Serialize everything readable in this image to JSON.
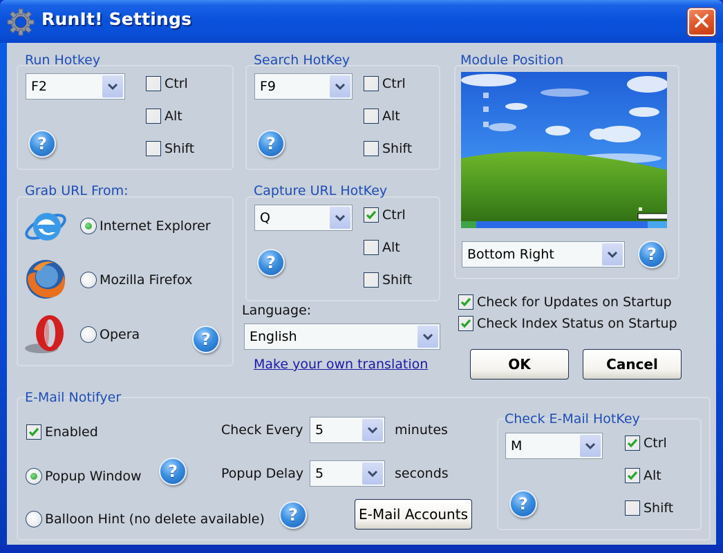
{
  "window": {
    "title": "RunIt! Settings",
    "app_icon": "gear-icon",
    "close_icon": "close-icon"
  },
  "run_hotkey": {
    "title": "Run Hotkey",
    "key": "F2",
    "modifiers": [
      {
        "label": "Ctrl",
        "checked": false
      },
      {
        "label": "Alt",
        "checked": false
      },
      {
        "label": "Shift",
        "checked": false
      }
    ],
    "help": "?"
  },
  "search_hotkey": {
    "title": "Search HotKey",
    "key": "F9",
    "modifiers": [
      {
        "label": "Ctrl",
        "checked": false
      },
      {
        "label": "Alt",
        "checked": false
      },
      {
        "label": "Shift",
        "checked": false
      }
    ],
    "help": "?"
  },
  "module_position": {
    "title": "Module Position",
    "preview_icon": "desktop-preview-image",
    "position": "Bottom Right",
    "help": "?"
  },
  "grab_url": {
    "title": "Grab URL From:",
    "browsers": [
      {
        "label": "Internet Explorer",
        "icon": "internet-explorer-icon",
        "selected": true
      },
      {
        "label": "Mozilla Firefox",
        "icon": "firefox-icon",
        "selected": false
      },
      {
        "label": "Opera",
        "icon": "opera-icon",
        "selected": false
      }
    ],
    "help": "?"
  },
  "capture_url_hotkey": {
    "title": "Capture URL HotKey",
    "key": "Q",
    "modifiers": [
      {
        "label": "Ctrl",
        "checked": true
      },
      {
        "label": "Alt",
        "checked": false
      },
      {
        "label": "Shift",
        "checked": false
      }
    ],
    "help": "?"
  },
  "language": {
    "label": "Language:",
    "value": "English",
    "translation_link": "Make your own translation"
  },
  "startup": {
    "check_updates": {
      "label": "Check for Updates on Startup",
      "checked": true
    },
    "check_index": {
      "label": "Check Index Status on Startup",
      "checked": true
    }
  },
  "buttons": {
    "ok": "OK",
    "cancel": "Cancel",
    "email_accounts": "E-Mail Accounts"
  },
  "email_notifier": {
    "title": "E-Mail Notifyer",
    "enabled": {
      "label": "Enabled",
      "checked": true
    },
    "display_modes": [
      {
        "label": "Popup Window",
        "selected": true
      },
      {
        "label": "Balloon Hint (no delete available)",
        "selected": false
      }
    ],
    "check_every": {
      "label": "Check Every",
      "value": "5",
      "unit": "minutes"
    },
    "popup_delay": {
      "label": "Popup Delay",
      "value": "5",
      "unit": "seconds"
    },
    "help": "?"
  },
  "check_email_hotkey": {
    "title": "Check E-Mail HotKey",
    "key": "M",
    "modifiers": [
      {
        "label": "Ctrl",
        "checked": true
      },
      {
        "label": "Alt",
        "checked": true
      },
      {
        "label": "Shift",
        "checked": false
      }
    ],
    "help": "?"
  },
  "colors": {
    "title_bar": "#0a52db",
    "group_title": "#1e4db5",
    "dialog_bg": "#c8d0db",
    "check_green": "#2aa52a",
    "link": "#1a1aa6",
    "close_button": "#e15a2c"
  }
}
